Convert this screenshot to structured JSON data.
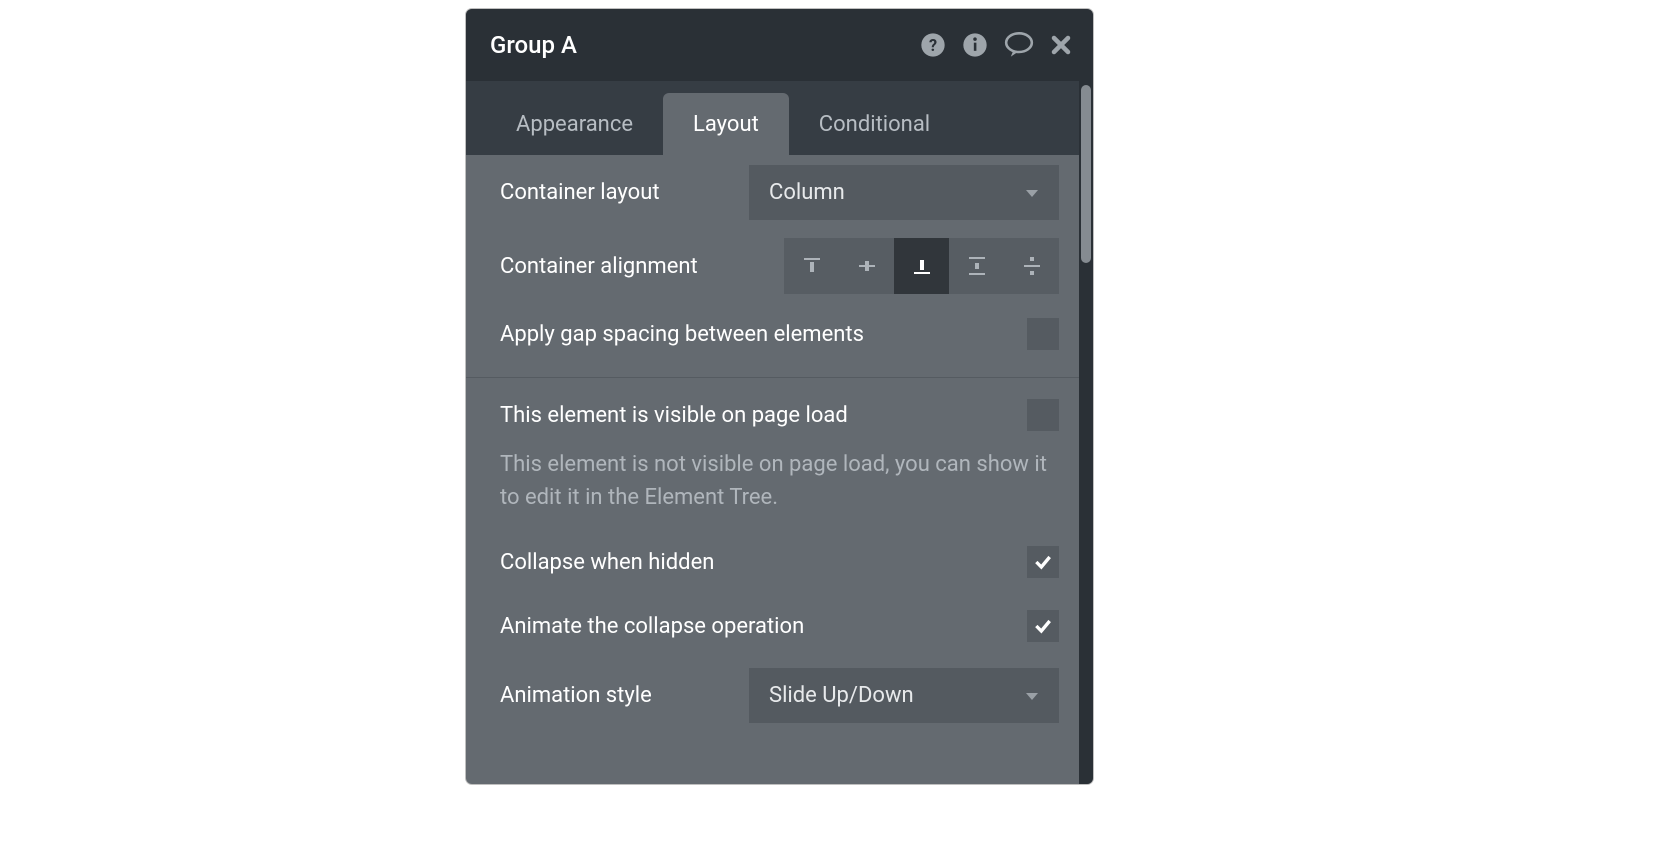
{
  "header": {
    "title": "Group A"
  },
  "tabs": [
    {
      "label": "Appearance",
      "active": false
    },
    {
      "label": "Layout",
      "active": true
    },
    {
      "label": "Conditional",
      "active": false
    }
  ],
  "layout": {
    "container_layout_label": "Container layout",
    "container_layout_value": "Column",
    "container_alignment_label": "Container alignment",
    "alignment_options": [
      {
        "name": "align-top",
        "active": false
      },
      {
        "name": "align-middle",
        "active": false
      },
      {
        "name": "align-bottom",
        "active": true
      },
      {
        "name": "align-space-between",
        "active": false
      },
      {
        "name": "align-space-around",
        "active": false
      }
    ],
    "gap_label": "Apply gap spacing between elements",
    "gap_checked": false
  },
  "visibility": {
    "visible_label": "This element is visible on page load",
    "visible_checked": false,
    "helper": "This element is not visible on page load, you can show it to edit it in the Element Tree.",
    "collapse_label": "Collapse when hidden",
    "collapse_checked": true,
    "animate_label": "Animate the collapse operation",
    "animate_checked": true,
    "animation_style_label": "Animation style",
    "animation_style_value": "Slide Up/Down"
  }
}
